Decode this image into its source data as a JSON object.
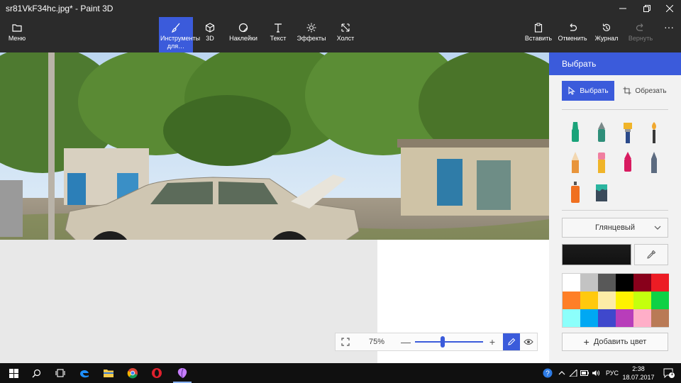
{
  "window": {
    "title": "sr81VkF34hc.jpg* - Paint 3D"
  },
  "toolbar": {
    "menu": "Меню",
    "brushes": "Инструменты для…",
    "d3": "3D",
    "stickers": "Наклейки",
    "text": "Текст",
    "effects": "Эффекты",
    "canvas": "Холст",
    "paste": "Вставить",
    "undo": "Отменить",
    "history": "Журнал",
    "redo": "Вернуть"
  },
  "zoom": {
    "value": "75%",
    "level": 0.4
  },
  "panel": {
    "title": "Выбрать",
    "select_btn": "Выбрать",
    "crop_btn": "Обрезать",
    "finish": "Глянцевый",
    "add_color": "Добавить цвет",
    "current_color": "#1c1c1c",
    "brushes": [
      {
        "name": "marker-icon",
        "color": "#1aa37a"
      },
      {
        "name": "calligraphy-pen-icon",
        "color": "#2f8f7a"
      },
      {
        "name": "oil-brush-icon",
        "color": "#f0b429"
      },
      {
        "name": "watercolor-icon",
        "color": "#f0a830"
      },
      {
        "name": "pixel-pen-icon",
        "color": "#e8943a"
      },
      {
        "name": "pencil-icon",
        "color": "#f07fa0"
      },
      {
        "name": "eraser-icon",
        "color": "#d81b60"
      },
      {
        "name": "crayon-icon",
        "color": "#5c6b80"
      },
      {
        "name": "spray-can-icon",
        "color": "#f07020"
      },
      {
        "name": "fill-bucket-icon",
        "color": "#2bb5a0"
      }
    ],
    "palette": [
      "#ffffff",
      "#c3c3c3",
      "#585858",
      "#000000",
      "#88001b",
      "#ec1c24",
      "#ff7f27",
      "#ffc90e",
      "#fdeca6",
      "#fff200",
      "#c4ff0e",
      "#0ed145",
      "#8cfffb",
      "#00a8f3",
      "#3f48cc",
      "#b83dba",
      "#ffaec8",
      "#b97a56"
    ]
  },
  "taskbar": {
    "lang": "РУС",
    "time": "2:38",
    "date": "18.07.2017",
    "notif_count": "1"
  }
}
